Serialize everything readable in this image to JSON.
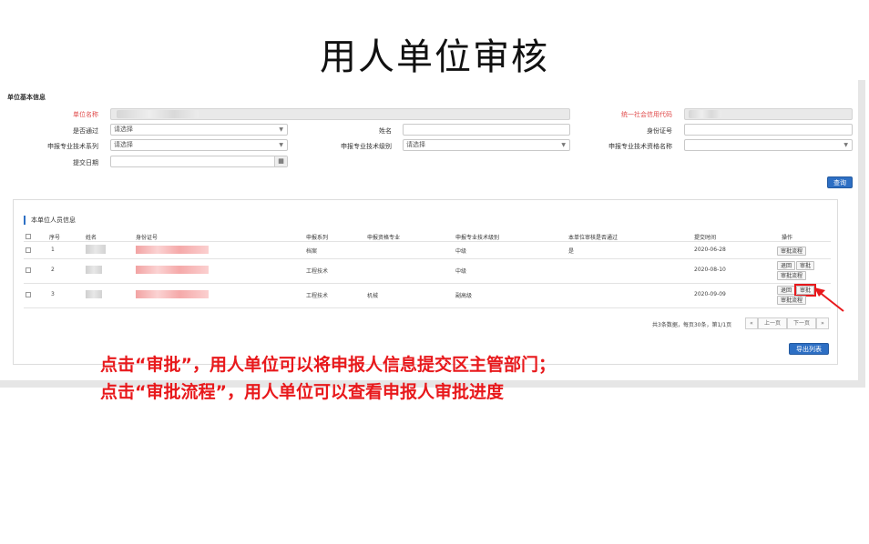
{
  "page": {
    "title": "用人单位审核"
  },
  "colors": {
    "accent": "#2d6fc4",
    "annotation": "#e8191c"
  },
  "basic_info": {
    "section_title": "单位基本信息",
    "labels": {
      "unit_name": "单位名称",
      "credit_code": "统一社会信用代码",
      "passed": "是否通过",
      "name": "姓名",
      "id_number": "身份证号",
      "tech_series": "申报专业技术系列",
      "tech_level": "申报专业技术级别",
      "qualification_name": "申报专业技术资格名称",
      "submit_date": "提交日期"
    },
    "placeholders": {
      "select": "请选择"
    },
    "query_button": "查询"
  },
  "staff_panel": {
    "title": "本单位人员信息",
    "columns": [
      "序号",
      "姓名",
      "身份证号",
      "申报系列",
      "申报资格专业",
      "申报专业技术级别",
      "本单位审核是否通过",
      "提交时间",
      "操作"
    ],
    "rows": [
      {
        "index": "1",
        "series": "档案",
        "major": "",
        "level": "中级",
        "passed": "是",
        "time": "2020-06-28",
        "actions": [
          "审批流程"
        ]
      },
      {
        "index": "2",
        "series": "工程技术",
        "major": "",
        "level": "中级",
        "passed": "",
        "time": "2020-08-10",
        "actions": [
          "退回",
          "审批",
          "审批流程"
        ]
      },
      {
        "index": "3",
        "series": "工程技术",
        "major": "机械",
        "level": "副高级",
        "passed": "",
        "time": "2020-09-09",
        "actions": [
          "退回",
          "审批",
          "审批流程"
        ]
      }
    ],
    "pagination": {
      "summary": "共3条数据，每页30条，第1/1页",
      "first": "«",
      "prev": "上一页",
      "next": "下一页",
      "last": "»"
    },
    "export_button": "导出列表"
  },
  "annotations": [
    "点击“审批”，用人单位可以将申报人信息提交区主管部门；",
    "点击“审批流程”，用人单位可以查看申报人审批进度"
  ]
}
